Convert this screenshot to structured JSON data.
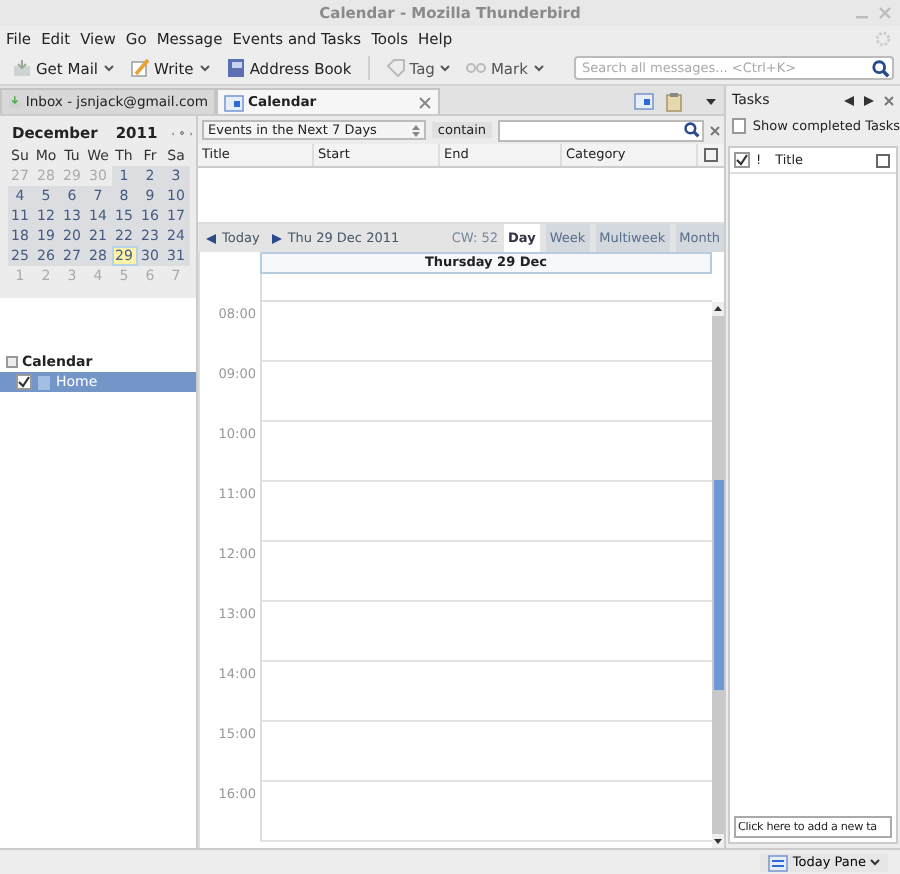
{
  "window": {
    "title": "Calendar - Mozilla Thunderbird"
  },
  "menu": [
    "File",
    "Edit",
    "View",
    "Go",
    "Message",
    "Events and Tasks",
    "Tools",
    "Help"
  ],
  "toolbar": [
    {
      "kind": "mail",
      "label": "Get Mail",
      "dropdown": true
    },
    {
      "kind": "write",
      "label": "Write",
      "dropdown": true
    },
    {
      "kind": "book",
      "label": "Address Book",
      "dropdown": false
    },
    {
      "kind": "tag",
      "label": "Tag",
      "dropdown": true
    },
    {
      "kind": "mark",
      "label": "Mark",
      "dropdown": true
    }
  ],
  "search": {
    "placeholder": "Search all messages... <Ctrl+K>"
  },
  "tabs": [
    {
      "kind": "mail",
      "label": "Inbox - jsnjack@gmail.com",
      "selected": false
    },
    {
      "kind": "calendar",
      "label": "Calendar",
      "selected": true
    }
  ],
  "minical": {
    "month": "December",
    "year": "2011",
    "weekdays": [
      "Su",
      "Mo",
      "Tu",
      "We",
      "Th",
      "Fr",
      "Sa"
    ],
    "weeks": [
      [
        {
          "label": "27",
          "other_month": true,
          "selected": false
        },
        {
          "label": "28",
          "other_month": true,
          "selected": false
        },
        {
          "label": "29",
          "other_month": true,
          "selected": false
        },
        {
          "label": "30",
          "other_month": true,
          "selected": false
        },
        {
          "label": "1",
          "other_month": false,
          "selected": false
        },
        {
          "label": "2",
          "other_month": false,
          "selected": false
        },
        {
          "label": "3",
          "other_month": false,
          "selected": false
        }
      ],
      [
        {
          "label": "4",
          "other_month": false,
          "selected": false
        },
        {
          "label": "5",
          "other_month": false,
          "selected": false
        },
        {
          "label": "6",
          "other_month": false,
          "selected": false
        },
        {
          "label": "7",
          "other_month": false,
          "selected": false
        },
        {
          "label": "8",
          "other_month": false,
          "selected": false
        },
        {
          "label": "9",
          "other_month": false,
          "selected": false
        },
        {
          "label": "10",
          "other_month": false,
          "selected": false
        }
      ],
      [
        {
          "label": "11",
          "other_month": false,
          "selected": false
        },
        {
          "label": "12",
          "other_month": false,
          "selected": false
        },
        {
          "label": "13",
          "other_month": false,
          "selected": false
        },
        {
          "label": "14",
          "other_month": false,
          "selected": false
        },
        {
          "label": "15",
          "other_month": false,
          "selected": false
        },
        {
          "label": "16",
          "other_month": false,
          "selected": false
        },
        {
          "label": "17",
          "other_month": false,
          "selected": false
        }
      ],
      [
        {
          "label": "18",
          "other_month": false,
          "selected": false
        },
        {
          "label": "19",
          "other_month": false,
          "selected": false
        },
        {
          "label": "20",
          "other_month": false,
          "selected": false
        },
        {
          "label": "21",
          "other_month": false,
          "selected": false
        },
        {
          "label": "22",
          "other_month": false,
          "selected": false
        },
        {
          "label": "23",
          "other_month": false,
          "selected": false
        },
        {
          "label": "24",
          "other_month": false,
          "selected": false
        }
      ],
      [
        {
          "label": "25",
          "other_month": false,
          "selected": false
        },
        {
          "label": "26",
          "other_month": false,
          "selected": false
        },
        {
          "label": "27",
          "other_month": false,
          "selected": false
        },
        {
          "label": "28",
          "other_month": false,
          "selected": false
        },
        {
          "label": "29",
          "other_month": false,
          "selected": true
        },
        {
          "label": "30",
          "other_month": false,
          "selected": false
        },
        {
          "label": "31",
          "other_month": false,
          "selected": false
        }
      ],
      [
        {
          "label": "1",
          "other_month": true,
          "selected": false
        },
        {
          "label": "2",
          "other_month": true,
          "selected": false
        },
        {
          "label": "3",
          "other_month": true,
          "selected": false
        },
        {
          "label": "4",
          "other_month": true,
          "selected": false
        },
        {
          "label": "5",
          "other_month": true,
          "selected": false
        },
        {
          "label": "6",
          "other_month": true,
          "selected": false
        },
        {
          "label": "7",
          "other_month": true,
          "selected": false
        }
      ]
    ]
  },
  "calendars": {
    "heading": "Calendar",
    "items": [
      {
        "label": "Home",
        "checked": true,
        "selected": true
      }
    ]
  },
  "filter": {
    "range": "Events in the Next 7 Days",
    "operator": "contain"
  },
  "events_table": {
    "columns": [
      "Title",
      "Start",
      "End",
      "Category"
    ]
  },
  "day_nav": {
    "today": "Today",
    "date": "Thu 29 Dec 2011",
    "week": "CW: 52"
  },
  "views": [
    {
      "label": "Day",
      "selected": true
    },
    {
      "label": "Week",
      "selected": false
    },
    {
      "label": "Multiweek",
      "selected": false
    },
    {
      "label": "Month",
      "selected": false
    }
  ],
  "day_view": {
    "heading": "Thursday 29 Dec",
    "hours": [
      "08:00",
      "09:00",
      "10:00",
      "11:00",
      "12:00",
      "13:00",
      "14:00",
      "15:00",
      "16:00"
    ]
  },
  "tasks": {
    "title": "Tasks",
    "show_completed": {
      "label": "Show completed Tasks",
      "checked": false
    },
    "columns": [
      "!",
      "Title"
    ],
    "new_task": {
      "placeholder": "Click here to add a new ta"
    }
  },
  "status_bar": {
    "today_pane": "Today Pane"
  }
}
